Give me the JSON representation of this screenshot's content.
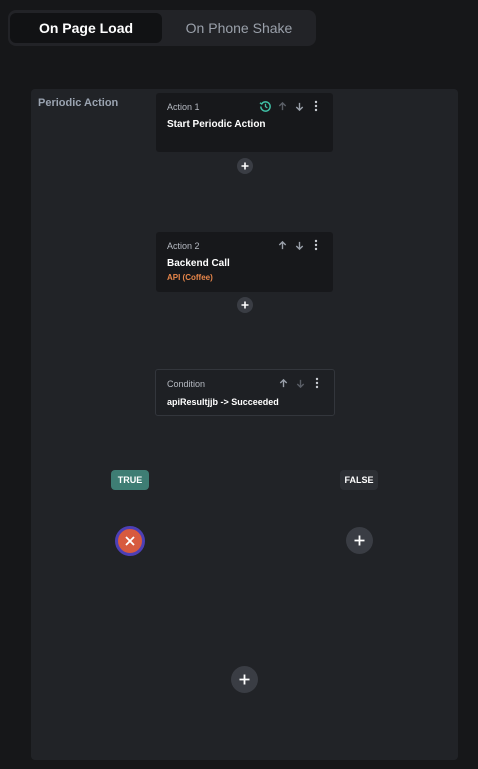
{
  "tabs": [
    {
      "label": "On Page Load",
      "active": true
    },
    {
      "label": "On Phone Shake",
      "active": false
    }
  ],
  "panel": {
    "title": "Periodic Action"
  },
  "actions": [
    {
      "label": "Action 1",
      "title": "Start Periodic Action"
    },
    {
      "label": "Action 2",
      "title": "Backend Call",
      "subtitle": "API (Coffee)"
    }
  ],
  "condition": {
    "label": "Condition",
    "text": "apiResultjjb -> Succeeded"
  },
  "branches": {
    "true_label": "TRUE",
    "false_label": "FALSE"
  },
  "colors": {
    "accent": "#4d3fb5",
    "true_badge": "#3e7d74",
    "stop": "#d75a3f",
    "periodic_icon": "#3fbfa5",
    "subtitle": "#e8864a"
  }
}
